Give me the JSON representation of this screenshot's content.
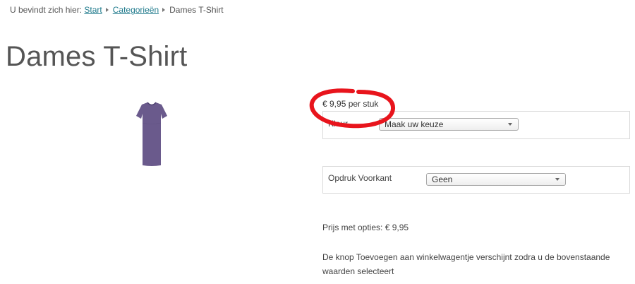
{
  "breadcrumb": {
    "prefix": "U bevindt zich hier:",
    "links": [
      "Start",
      "Categorieën"
    ],
    "current": "Dames T-Shirt"
  },
  "product": {
    "title": "Dames T-Shirt",
    "image_icon": "tshirt-icon",
    "price_per_unit": "€ 9,95 per stuk"
  },
  "options": {
    "color": {
      "label": "Kleur",
      "selected": "Maak uw keuze"
    },
    "front_print": {
      "label": "Opdruk Voorkant",
      "selected": "Geen"
    }
  },
  "price_with_options": "Prijs met opties: € 9,95",
  "add_to_cart_notice": "De knop Toevoegen aan winkelwagentje verschijnt zodra u de bovenstaande waarden selecteert",
  "colors": {
    "link": "#1f7a8c",
    "shirt": "#6a5a8c",
    "annotation": "#e8141c"
  }
}
